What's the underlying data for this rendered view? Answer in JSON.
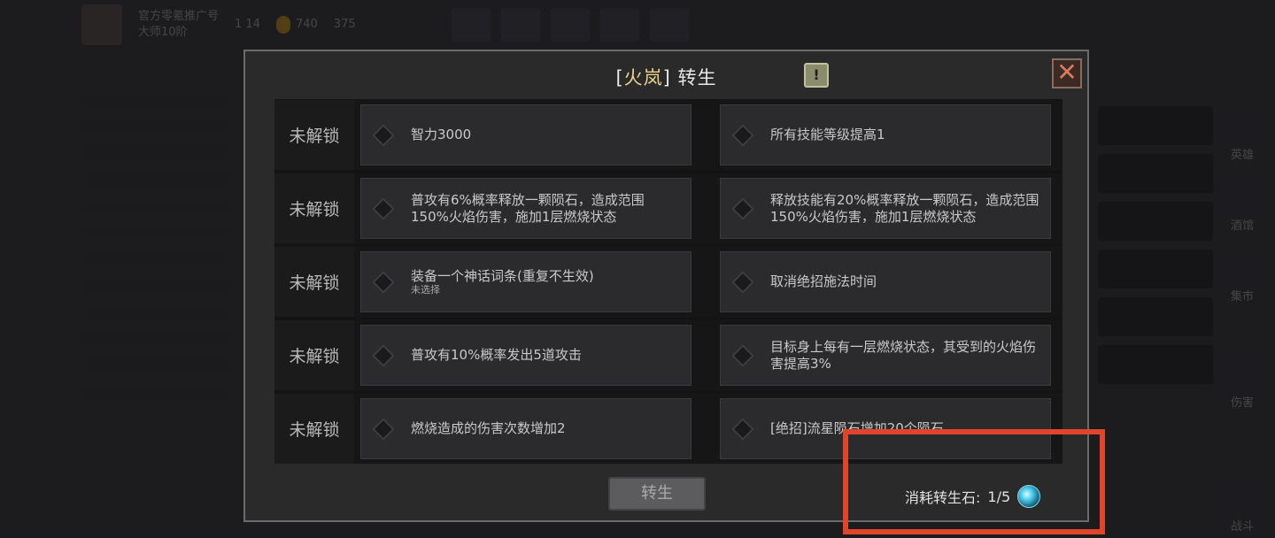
{
  "dialog": {
    "title_open": "[",
    "hero_name": "火岚",
    "title_close": "]",
    "title_rest": " 转生",
    "help_glyph": "!",
    "close_glyph": "✕",
    "locked_label": "未解锁",
    "rows": [
      {
        "left": "智力3000",
        "left_sub": "",
        "right": "所有技能等级提高1"
      },
      {
        "left": "普攻有6%概率释放一颗陨石，造成范围150%火焰伤害，施加1层燃烧状态",
        "left_sub": "",
        "right": "释放技能有20%概率释放一颗陨石，造成范围150%火焰伤害，施加1层燃烧状态"
      },
      {
        "left": "装备一个神话词条(重复不生效)",
        "left_sub": "未选择",
        "right": "取消绝招施法时间"
      },
      {
        "left": "普攻有10%概率发出5道攻击",
        "left_sub": "",
        "right": "目标身上每有一层燃烧状态，其受到的火焰伤害提高3%"
      },
      {
        "left": "燃烧造成的伤害次数增加2",
        "left_sub": "",
        "right": "[绝招]流星陨石增加20个陨石"
      }
    ],
    "rebirth_button": "转生",
    "cost_label": "消耗转生石:",
    "cost_value": "1/5",
    "cost_icon": "rebirth-stone-icon"
  },
  "background": {
    "player_line1": "官方零氪推广号",
    "player_line2": "大师10阶",
    "stat1": "1 14",
    "stat2": "740",
    "stat3": "375",
    "side_items": [
      "英雄",
      "酒馆",
      "集市",
      "伤害",
      "战斗"
    ]
  },
  "colors": {
    "hero_name": "#e8d48a",
    "highlight_box": "#e0442a",
    "modal_bg": "#2a2a2b"
  }
}
